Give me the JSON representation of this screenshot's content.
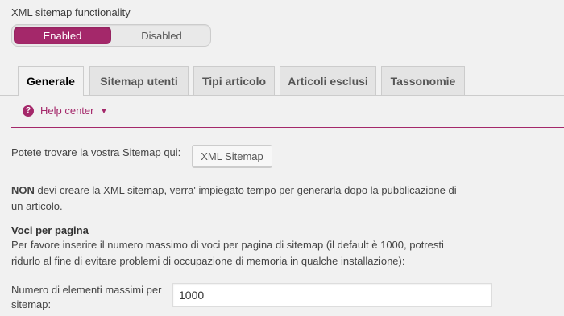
{
  "feature": {
    "title": "XML sitemap functionality",
    "toggle": {
      "enabled_label": "Enabled",
      "disabled_label": "Disabled",
      "selected": "Enabled"
    }
  },
  "tabs": [
    {
      "label": "Generale",
      "active": true
    },
    {
      "label": "Sitemap utenti",
      "active": false
    },
    {
      "label": "Tipi articolo",
      "active": false
    },
    {
      "label": "Articoli esclusi",
      "active": false
    },
    {
      "label": "Tassonomie",
      "active": false
    }
  ],
  "help": {
    "icon": "question-circle-icon",
    "label": "Help center",
    "caret": "▼"
  },
  "content": {
    "find_text": "Potete trovare la vostra Sitemap qui:",
    "sitemap_button": "XML Sitemap",
    "notice_bold": "NON",
    "notice_rest_line1": " devi creare la XML sitemap, verra' impiegato tempo per generarla dopo la pubblicazione di",
    "notice_line2": "un articolo.",
    "per_page_heading": "Voci per pagina",
    "per_page_desc_line1": "Per favore inserire il numero massimo di voci per pagina di sitemap (il default è 1000, potresti",
    "per_page_desc_line2": "ridurlo al fine di evitare problemi di occupazione di memoria in qualche installazione):",
    "field_label_line1": "Numero di elementi massimi per",
    "field_label_line2": "sitemap:",
    "field_value": "1000"
  },
  "colors": {
    "accent": "#a4286a",
    "background": "#f1f1f1"
  }
}
